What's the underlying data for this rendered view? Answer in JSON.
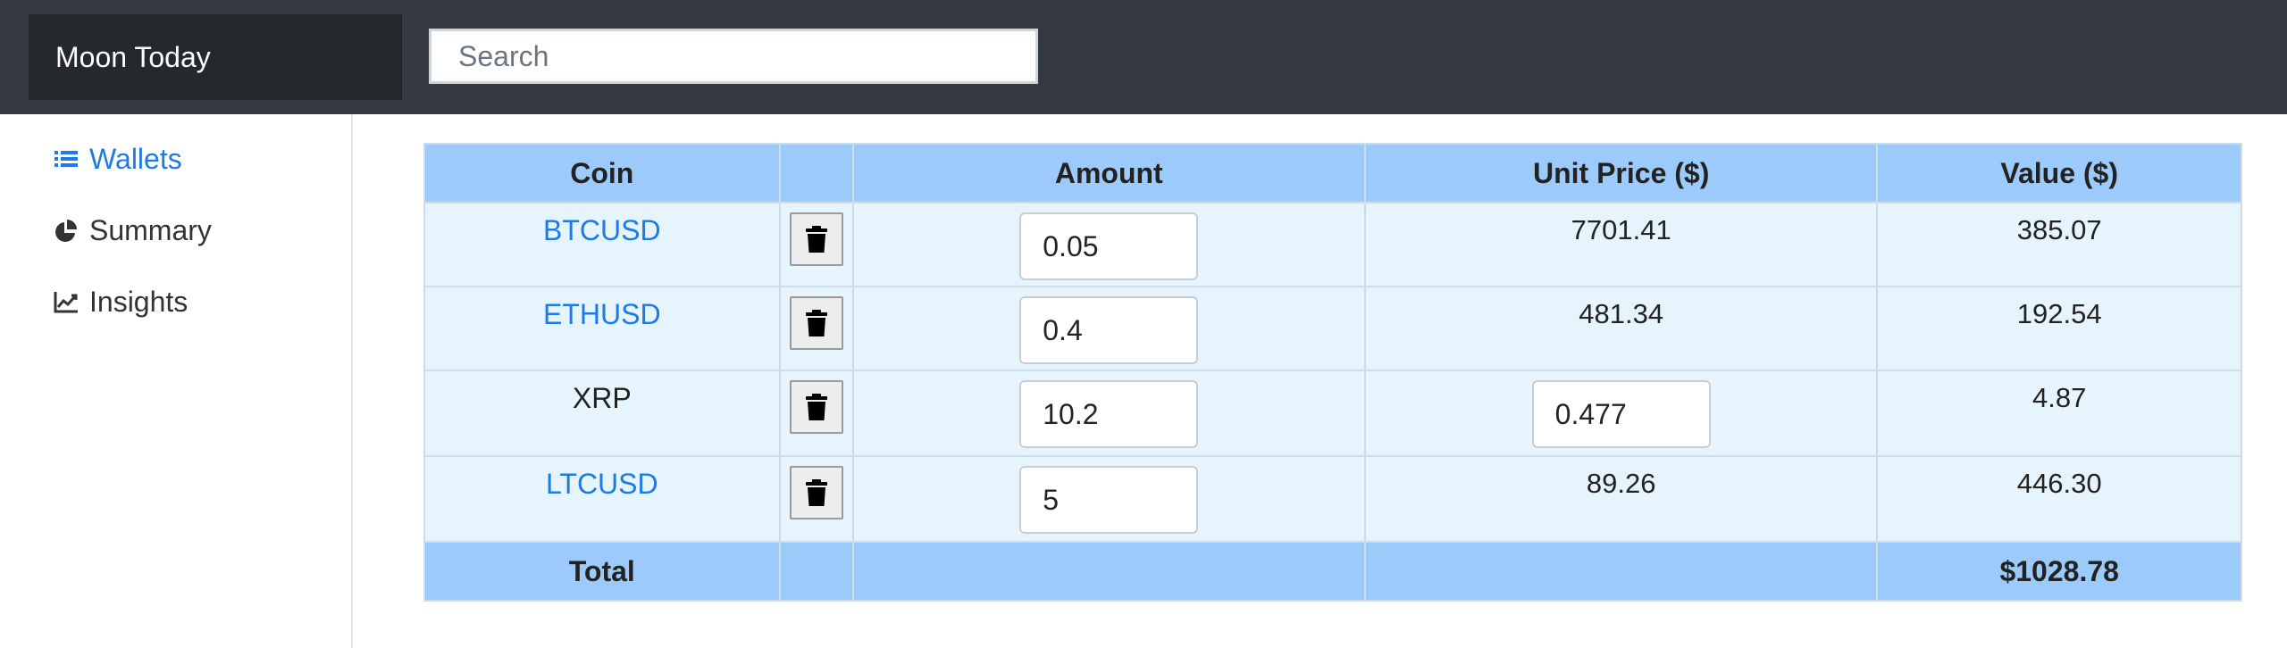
{
  "navbar": {
    "brand": "Moon Today",
    "search_placeholder": "Search"
  },
  "sidebar": {
    "items": [
      {
        "label": "Wallets",
        "icon": "list-icon",
        "active": true
      },
      {
        "label": "Summary",
        "icon": "pie-chart-icon",
        "active": false
      },
      {
        "label": "Insights",
        "icon": "line-chart-icon",
        "active": false
      }
    ]
  },
  "table": {
    "headers": {
      "coin": "Coin",
      "actions": "",
      "amount": "Amount",
      "unit_price": "Unit Price ($)",
      "value": "Value ($)"
    },
    "rows": [
      {
        "coin": "BTCUSD",
        "amount": "0.05",
        "unit_price": "7701.41",
        "value": "385.07"
      },
      {
        "coin": "ETHUSD",
        "amount": "0.4",
        "unit_price": "481.34",
        "value": "192.54"
      },
      {
        "coin": "XRP",
        "amount": "10.2",
        "unit_price": "0.477",
        "value": "4.87"
      },
      {
        "coin": "LTCUSD",
        "amount": "5",
        "unit_price": "89.26",
        "value": "446.30"
      }
    ],
    "footer": {
      "label": "Total",
      "total": "$1028.78"
    }
  },
  "colors": {
    "navbar_bg": "#343a40",
    "brand_bg": "#25282d",
    "accent": "#1e7be5",
    "header_bg": "#9ccbfb",
    "row_bg": "#e6f4fd"
  }
}
